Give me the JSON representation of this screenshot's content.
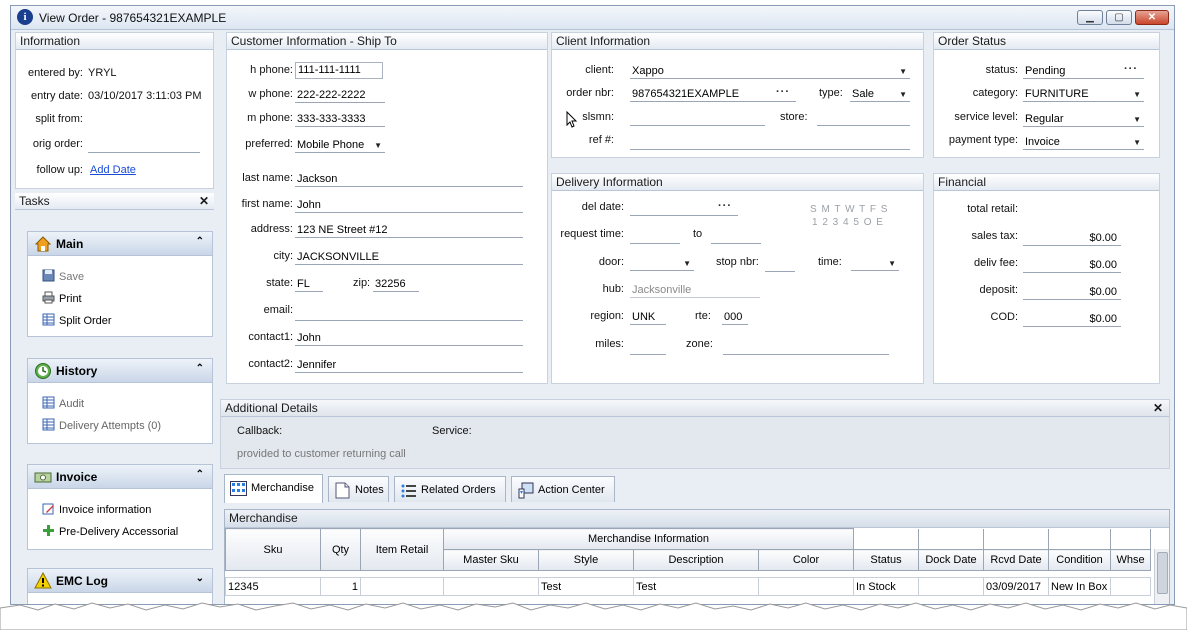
{
  "window": {
    "title": "View Order - 987654321EXAMPLE"
  },
  "information": {
    "header": "Information",
    "entered_by_label": "entered by:",
    "entered_by": "YRYL",
    "entry_date_label": "entry date:",
    "entry_date": "03/10/2017 3:11:03 PM",
    "split_from_label": "split from:",
    "orig_order_label": "orig order:",
    "follow_up_label": "follow up:",
    "follow_up_link": "Add Date"
  },
  "tasks": {
    "header": "Tasks",
    "main": {
      "title": "Main",
      "items": [
        "Save",
        "Print",
        "Split Order"
      ]
    },
    "history": {
      "title": "History",
      "items": [
        "Audit",
        "Delivery Attempts (0)"
      ]
    },
    "invoice": {
      "title": "Invoice",
      "items": [
        "Invoice information",
        "Pre-Delivery Accessorial"
      ]
    },
    "emc": {
      "title": "EMC Log"
    }
  },
  "customer": {
    "header": "Customer Information - Ship To",
    "h_phone_label": "h phone:",
    "h_phone": "111-111-1111",
    "w_phone_label": "w phone:",
    "w_phone": "222-222-2222",
    "m_phone_label": "m phone:",
    "m_phone": "333-333-3333",
    "preferred_label": "preferred:",
    "preferred": "Mobile Phone",
    "last_name_label": "last name:",
    "last_name": "Jackson",
    "first_name_label": "first name:",
    "first_name": "John",
    "address_label": "address:",
    "address": "123 NE Street #12",
    "city_label": "city:",
    "city": "JACKSONVILLE",
    "state_label": "state:",
    "state": "FL",
    "zip_label": "zip:",
    "zip": "32256",
    "email_label": "email:",
    "contact1_label": "contact1:",
    "contact1": "John",
    "contact2_label": "contact2:",
    "contact2": "Jennifer"
  },
  "client": {
    "header": "Client Information",
    "client_label": "client:",
    "client": "Xappo",
    "order_nbr_label": "order nbr:",
    "order_nbr": "987654321EXAMPLE",
    "type_label": "type:",
    "type": "Sale",
    "slsmn_label": "slsmn:",
    "store_label": "store:",
    "ref_label": "ref #:"
  },
  "order_status": {
    "header": "Order Status",
    "status_label": "status:",
    "status": "Pending",
    "category_label": "category:",
    "category": "FURNITURE",
    "service_level_label": "service level:",
    "service_level": "Regular",
    "payment_type_label": "payment type:",
    "payment_type": "Invoice"
  },
  "delivery": {
    "header": "Delivery Information",
    "del_date_label": "del date:",
    "request_time_label": "request time:",
    "to_label": "to",
    "door_label": "door:",
    "stop_nbr_label": "stop nbr:",
    "time_label": "time:",
    "hub_label": "hub:",
    "hub": "Jacksonville",
    "region_label": "region:",
    "region": "UNK",
    "rte_label": "rte:",
    "rte": "000",
    "miles_label": "miles:",
    "zone_label": "zone:",
    "week_days": "S M T W T F S",
    "week_nums": "1 2 3 4 5 O E"
  },
  "financial": {
    "header": "Financial",
    "total_retail_label": "total retail:",
    "sales_tax_label": "sales tax:",
    "sales_tax": "$0.00",
    "deliv_fee_label": "deliv fee:",
    "deliv_fee": "$0.00",
    "deposit_label": "deposit:",
    "deposit": "$0.00",
    "cod_label": "COD:",
    "cod": "$0.00"
  },
  "additional": {
    "header": "Additional Details",
    "callback_label": "Callback:",
    "service_label": "Service:",
    "note": "provided to customer returning call"
  },
  "tabs": [
    "Merchandise",
    "Notes",
    "Related Orders",
    "Action Center"
  ],
  "merchandise": {
    "header": "Merchandise",
    "group_header": "Merchandise Information",
    "columns": {
      "sku": "Sku",
      "qty": "Qty",
      "item_retail": "Item Retail",
      "master_sku": "Master Sku",
      "style": "Style",
      "description": "Description",
      "color": "Color",
      "status": "Status",
      "dock_date": "Dock Date",
      "rcvd_date": "Rcvd Date",
      "condition": "Condition",
      "whse": "Whse"
    },
    "rows": [
      {
        "sku": "12345",
        "qty": "1",
        "item_retail": "",
        "master_sku": "",
        "style": "Test",
        "description": "Test",
        "color": "",
        "status": "In Stock",
        "dock_date": "",
        "rcvd_date": "03/09/2017",
        "condition": "New In Box",
        "whse": ""
      }
    ]
  }
}
